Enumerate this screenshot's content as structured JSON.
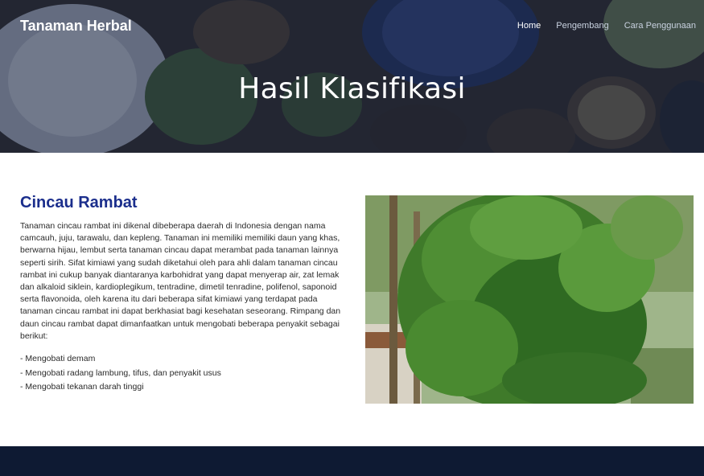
{
  "header": {
    "brand": "Tanaman Herbal",
    "nav": [
      "Home",
      "Pengembang",
      "Cara Penggunaan"
    ],
    "hero_title": "Hasil Klasifikasi"
  },
  "result": {
    "plant_name": "Cincau Rambat",
    "description": "Tanaman cincau rambat ini dikenal dibeberapa daerah di Indonesia dengan nama camcauh, juju, tarawalu, dan kepleng. Tanaman ini memiliki memiliki daun yang khas, berwarna hijau, lembut serta tanaman cincau dapat merambat pada tanaman lainnya seperti sirih. Sifat kimiawi yang sudah diketahui oleh para ahli dalam tanaman cincau rambat ini cukup banyak diantaranya karbohidrat yang dapat menyerap air, zat lemak dan alkaloid siklein, kardioplegikum, tentradine, dimetil tenradine, polifenol, saponoid serta flavonoida, oleh karena itu dari beberapa sifat kimiawi yang terdapat pada tanaman cincau rambat ini dapat berkhasiat bagi kesehatan seseorang. Rimpang dan daun cincau rambat dapat dimanfaatkan untuk mengobati beberapa penyakit sebagai berikut:",
    "benefits": [
      "Mengobati demam",
      "Mengobati radang lambung, tifus, dan penyakit usus",
      "Mengobati tekanan darah tinggi"
    ]
  },
  "colors": {
    "hero_overlay": "#1f2a3d",
    "title_blue": "#1b2e8c",
    "footer": "#0e1a33"
  }
}
